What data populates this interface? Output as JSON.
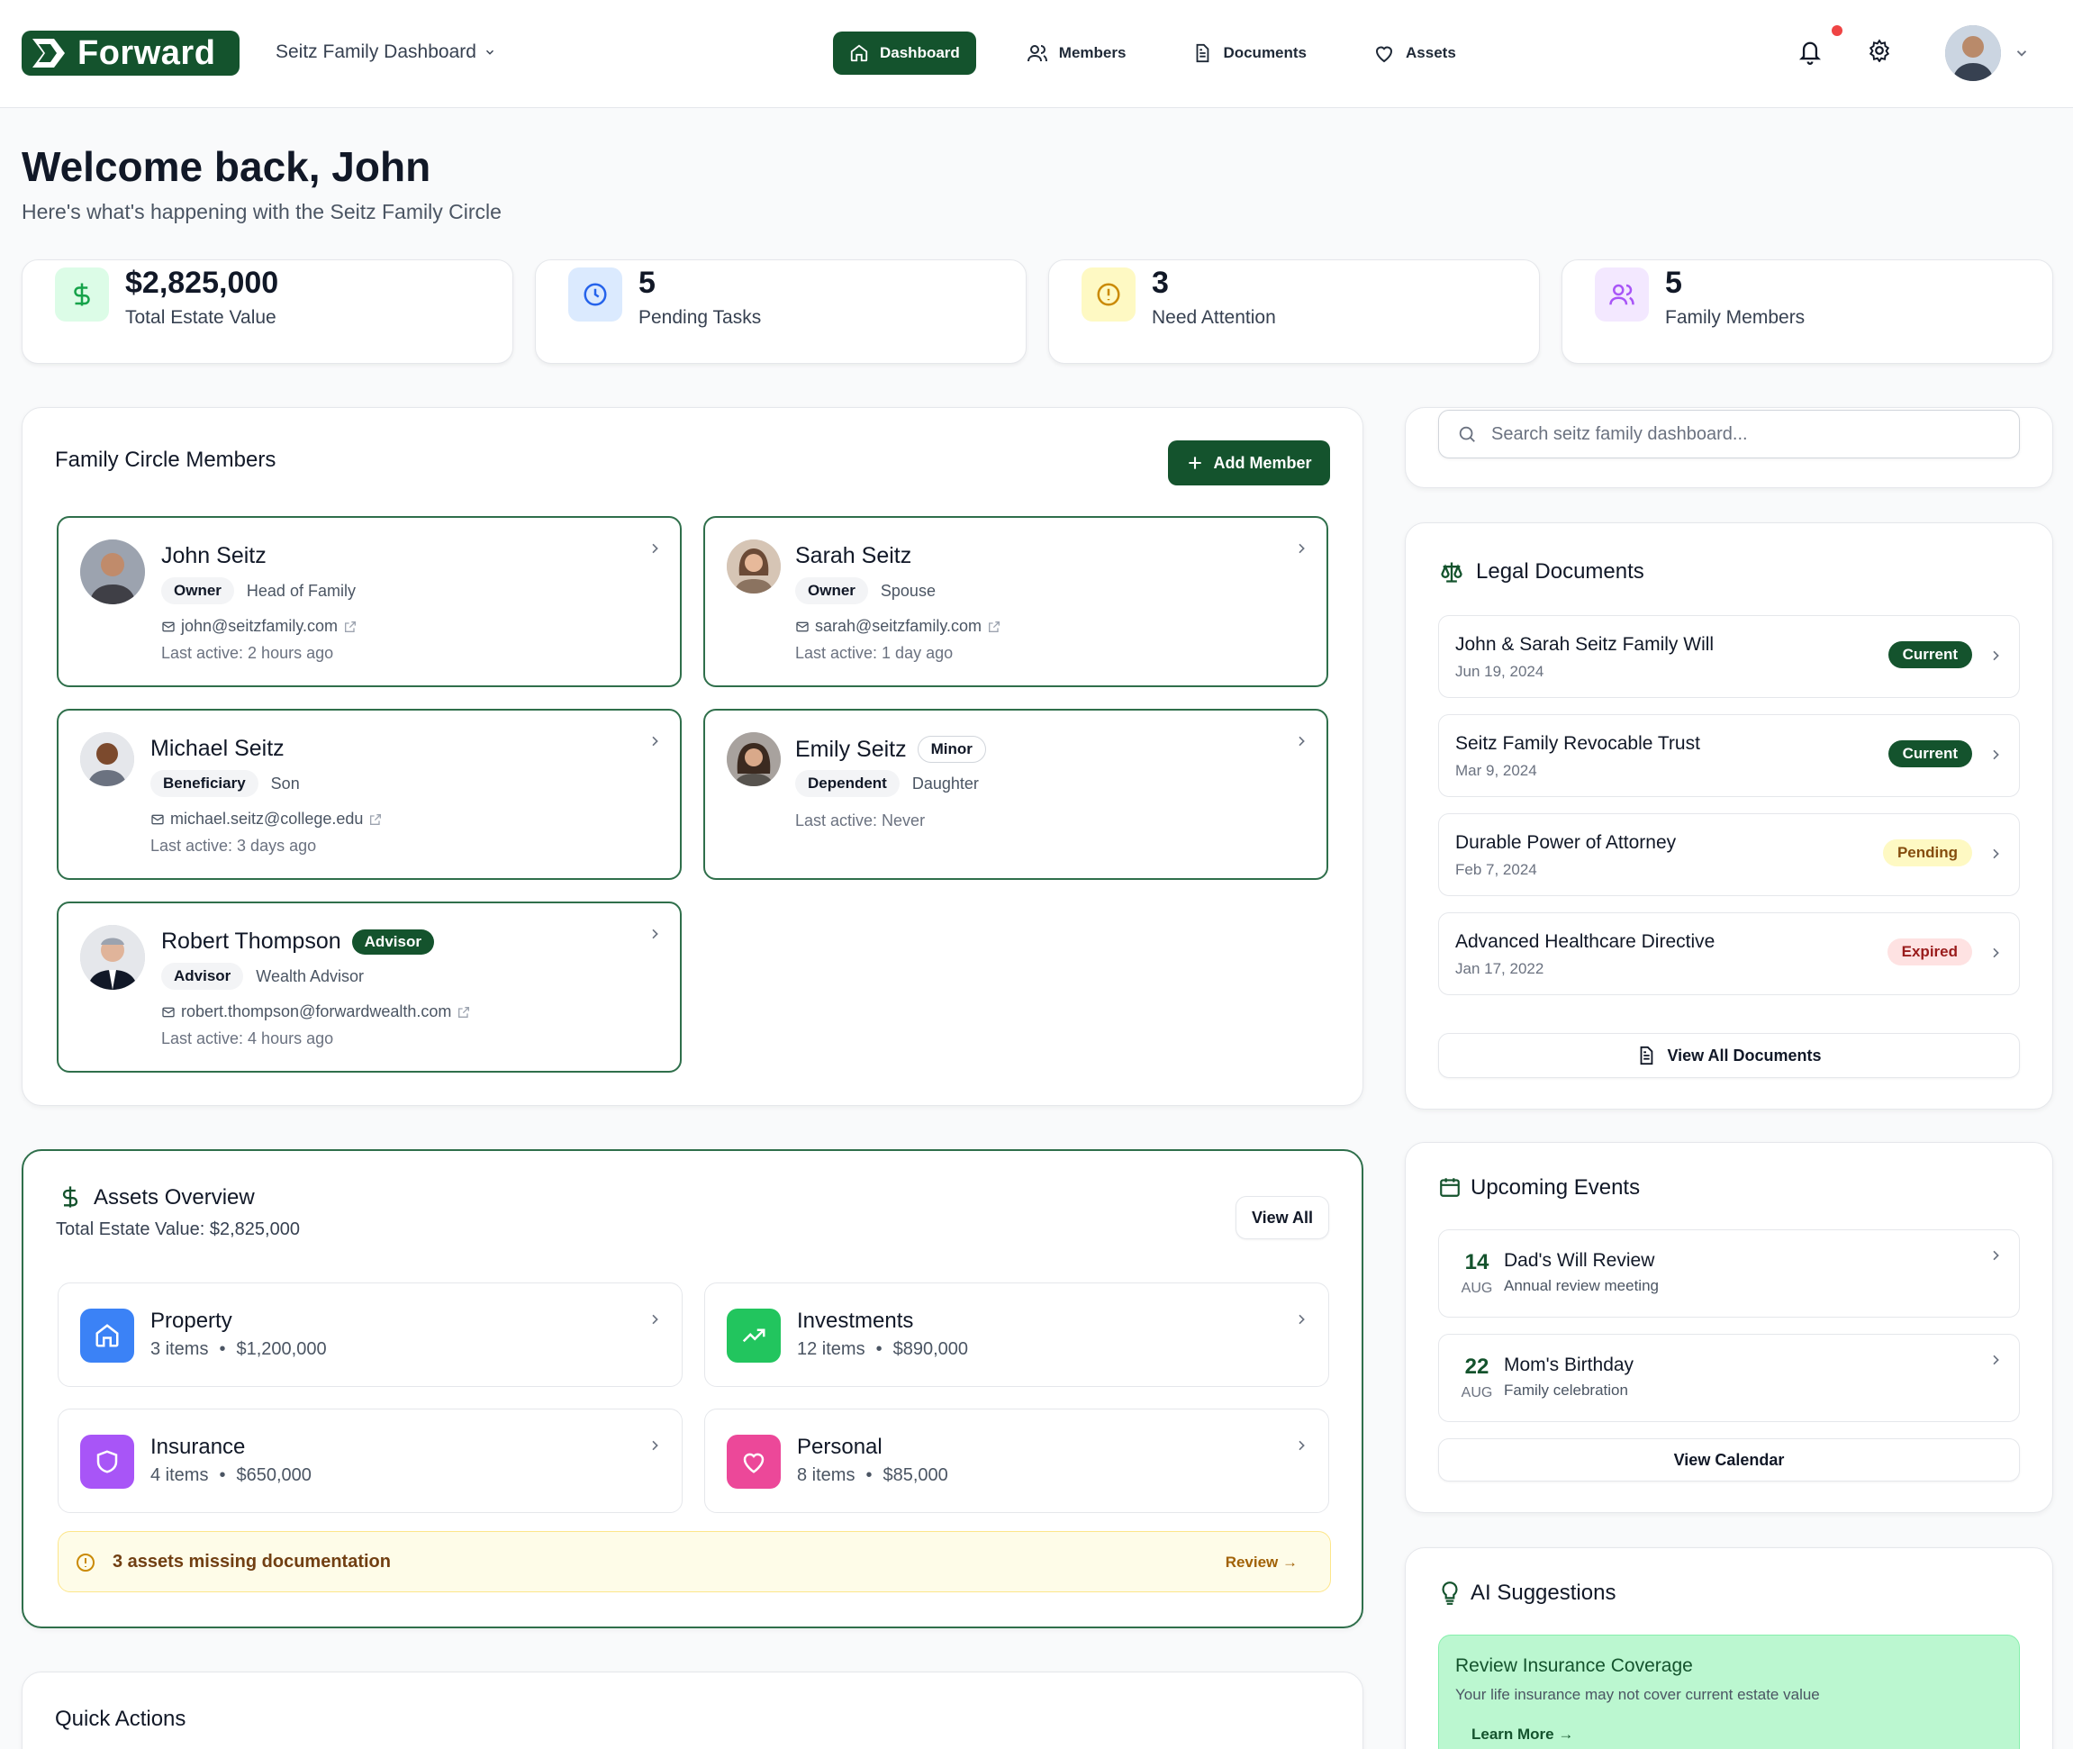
{
  "brand": {
    "logo_text": "Forward",
    "accent": "#14532d"
  },
  "header": {
    "family_selector": "Seitz Family Dashboard",
    "nav": [
      {
        "label": "Dashboard",
        "icon": "home-icon",
        "active": true
      },
      {
        "label": "Members",
        "icon": "users-icon",
        "active": false
      },
      {
        "label": "Documents",
        "icon": "document-icon",
        "active": false
      },
      {
        "label": "Assets",
        "icon": "heart-icon",
        "active": false
      }
    ]
  },
  "welcome": {
    "title": "Welcome back, John",
    "subtitle": "Here's what's happening with the Seitz Family Circle"
  },
  "stats": [
    {
      "value": "$2,825,000",
      "label": "Total Estate Value",
      "icon": "dollar-icon"
    },
    {
      "value": "5",
      "label": "Pending Tasks",
      "icon": "clock-icon"
    },
    {
      "value": "3",
      "label": "Need Attention",
      "icon": "alert-icon"
    },
    {
      "value": "5",
      "label": "Family Members",
      "icon": "users-icon"
    }
  ],
  "members_panel": {
    "title": "Family Circle Members",
    "add_label": "Add Member",
    "members": [
      {
        "name": "John Seitz",
        "tag": "",
        "role": "Owner",
        "relation": "Head of Family",
        "email": "john@seitzfamily.com",
        "last_active": "Last active: 2 hours ago"
      },
      {
        "name": "Sarah Seitz",
        "tag": "",
        "role": "Owner",
        "relation": "Spouse",
        "email": "sarah@seitzfamily.com",
        "last_active": "Last active: 1 day ago"
      },
      {
        "name": "Michael Seitz",
        "tag": "",
        "role": "Beneficiary",
        "relation": "Son",
        "email": "michael.seitz@college.edu",
        "last_active": "Last active: 3 days ago"
      },
      {
        "name": "Emily Seitz",
        "tag": "Minor",
        "role": "Dependent",
        "relation": "Daughter",
        "email": "",
        "last_active": "Last active: Never"
      },
      {
        "name": "Robert Thompson",
        "tag": "Advisor",
        "role": "Advisor",
        "relation": "Wealth Advisor",
        "email": "robert.thompson@forwardwealth.com",
        "last_active": "Last active: 4 hours ago"
      }
    ]
  },
  "assets_panel": {
    "title": "Assets Overview",
    "subtitle": "Total Estate Value: $2,825,000",
    "view_all": "View All",
    "categories": [
      {
        "name": "Property",
        "items": "3 items",
        "value": "$1,200,000",
        "color": "#3b82f6",
        "icon": "home-icon"
      },
      {
        "name": "Investments",
        "items": "12 items",
        "value": "$890,000",
        "color": "#22c55e",
        "icon": "trending-up-icon"
      },
      {
        "name": "Insurance",
        "items": "4 items",
        "value": "$650,000",
        "color": "#a855f7",
        "icon": "shield-icon"
      },
      {
        "name": "Personal",
        "items": "8 items",
        "value": "$85,000",
        "color": "#ec4899",
        "icon": "heart-icon"
      }
    ],
    "warning": "3 assets missing documentation",
    "warning_action": "Review →"
  },
  "quick_actions": {
    "title": "Quick Actions"
  },
  "search": {
    "placeholder": "Search seitz family dashboard..."
  },
  "legal_panel": {
    "title": "Legal Documents",
    "documents": [
      {
        "title": "John & Sarah Seitz Family Will",
        "date": "Jun 19, 2024",
        "status": "Current"
      },
      {
        "title": "Seitz Family Revocable Trust",
        "date": "Mar 9, 2024",
        "status": "Current"
      },
      {
        "title": "Durable Power of Attorney",
        "date": "Feb 7, 2024",
        "status": "Pending"
      },
      {
        "title": "Advanced Healthcare Directive",
        "date": "Jan 17, 2022",
        "status": "Expired"
      }
    ],
    "view_all": "View All Documents"
  },
  "events_panel": {
    "title": "Upcoming Events",
    "events": [
      {
        "day": "14",
        "month": "AUG",
        "title": "Dad's Will Review",
        "subtitle": "Annual review meeting"
      },
      {
        "day": "22",
        "month": "AUG",
        "title": "Mom's Birthday",
        "subtitle": "Family celebration"
      }
    ],
    "view_calendar": "View Calendar"
  },
  "ai_panel": {
    "title": "AI Suggestions",
    "suggestion": {
      "title": "Review Insurance Coverage",
      "text": "Your life insurance may not cover current estate value",
      "action": "Learn More →"
    }
  }
}
